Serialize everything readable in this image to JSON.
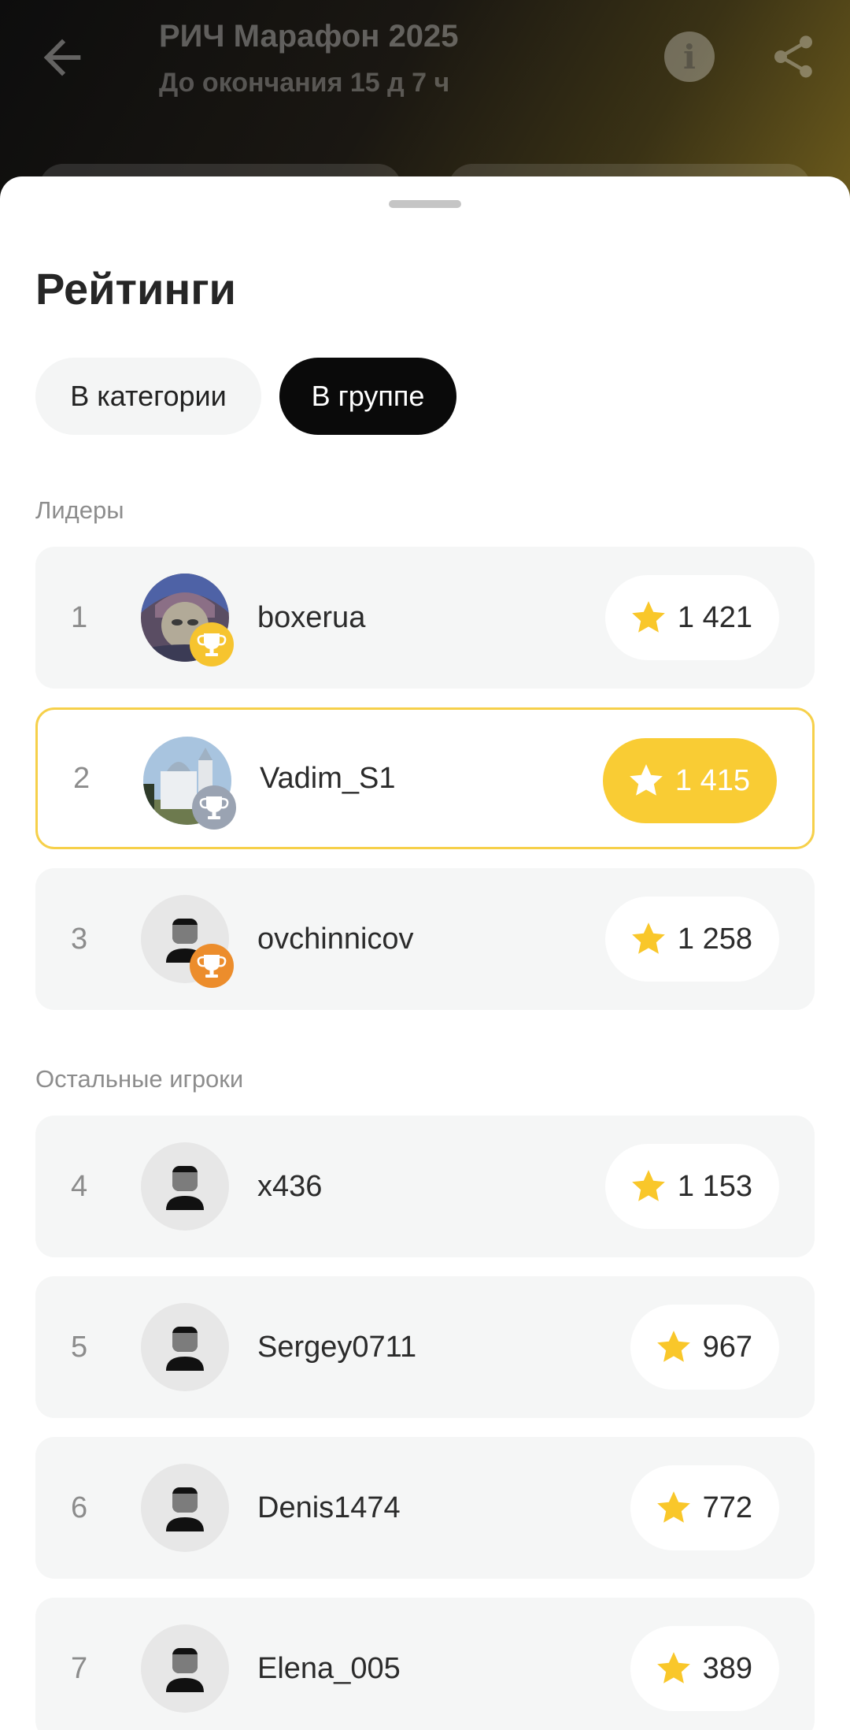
{
  "header": {
    "title": "РИЧ Марафон 2025",
    "subtitle": "До окончания 15 д 7 ч"
  },
  "sheet": {
    "title": "Рейтинги",
    "tabs": [
      {
        "label": "В категории",
        "selected": false
      },
      {
        "label": "В группе",
        "selected": true
      }
    ],
    "leaders_label": "Лидеры",
    "others_label": "Остальные игроки",
    "leaders": [
      {
        "rank": "1",
        "name": "boxerua",
        "score": "1 421",
        "medal": "gold",
        "avatar": "photo"
      },
      {
        "rank": "2",
        "name": "Vadim_S1",
        "score": "1 415",
        "medal": "silver",
        "avatar": "photo",
        "highlighted": true
      },
      {
        "rank": "3",
        "name": "ovchinnicov",
        "score": "1 258",
        "medal": "bronze",
        "avatar": "default"
      }
    ],
    "others": [
      {
        "rank": "4",
        "name": "x436",
        "score": "1 153",
        "avatar": "default"
      },
      {
        "rank": "5",
        "name": "Sergey0711",
        "score": "967",
        "avatar": "default"
      },
      {
        "rank": "6",
        "name": "Denis1474",
        "score": "772",
        "avatar": "default"
      },
      {
        "rank": "7",
        "name": "Elena_005",
        "score": "389",
        "avatar": "default"
      }
    ]
  },
  "colors": {
    "accent": "#F9CC34",
    "gold_medal": "#F6C42F",
    "silver_medal": "#9AA3B2",
    "bronze_medal": "#EC8D2C",
    "active_tab": "#0A0A0A"
  },
  "icons": [
    "arrow-back-icon",
    "info-icon",
    "share-icon",
    "star-icon",
    "trophy-icon",
    "default-avatar-icon"
  ]
}
